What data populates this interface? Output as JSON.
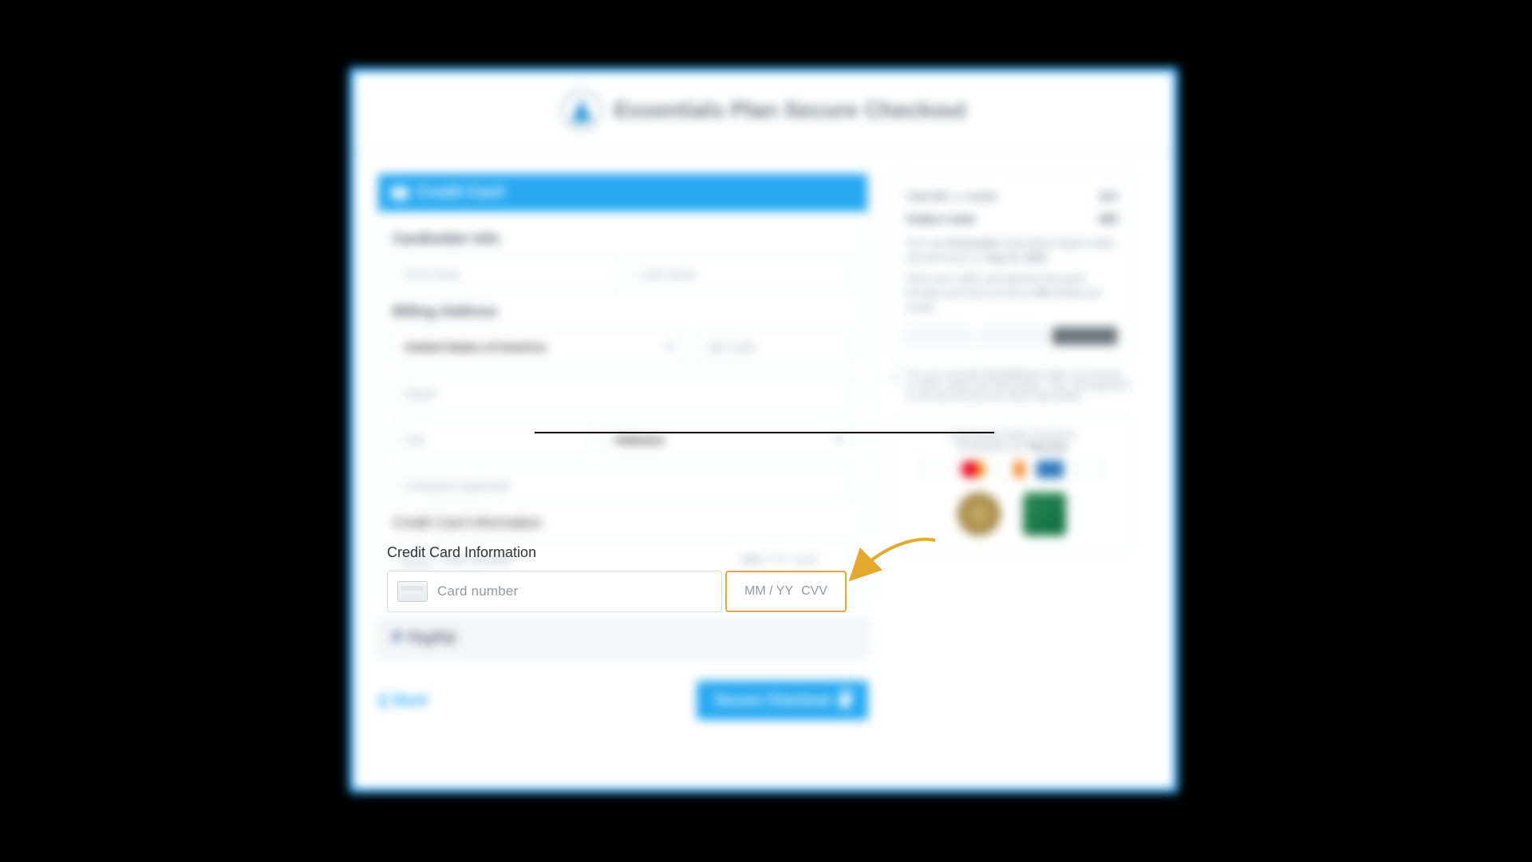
{
  "header": {
    "title": "Essentials Plan Secure Checkout"
  },
  "credit_card": {
    "tab_label": "Credit Card",
    "cardholder_title": "Cardholder Info",
    "first_name_placeholder": "First name",
    "last_name_placeholder": "Last name",
    "billing_title": "Billing Address",
    "country_selected": "United States of America",
    "zip_placeholder": "Zip Code",
    "street_placeholder": "Street",
    "city_placeholder": "City",
    "state_selected": "Alabama",
    "company_placeholder": "Company (optional)",
    "cc_info_title": "Credit Card Information",
    "card_number_placeholder": "Card number",
    "expiry_placeholder": "MM / YY",
    "cvv_placeholder": "CVV"
  },
  "paypal": {
    "label": "PayPal"
  },
  "actions": {
    "back_label": "❮ Back",
    "checkout_label": "Secure Checkout"
  },
  "summary": {
    "line1_label": "Total Bill / 1 month",
    "line1_value": "$99",
    "total_label": "Today's total:",
    "total_value": "$99",
    "note1_prefix": "Your new ",
    "note1_bold": "Essentials",
    "note1_mid": " subscription begins today and will renew on ",
    "note1_date": "Aug 13, 2023.",
    "note2_prefix": "Once your credit card payment has gone through you'll have access to ",
    "note2_bold": "80",
    "note2_suffix": " lookups per month."
  },
  "security_note": "For your security RocketReach does not process or store credit card information. Your card payment is secured by Recurly. More information.",
  "safe": {
    "title": "Guaranteed Safe Checkout",
    "powered_prefix": "POWERED BY ",
    "powered_name": "Recurly"
  }
}
